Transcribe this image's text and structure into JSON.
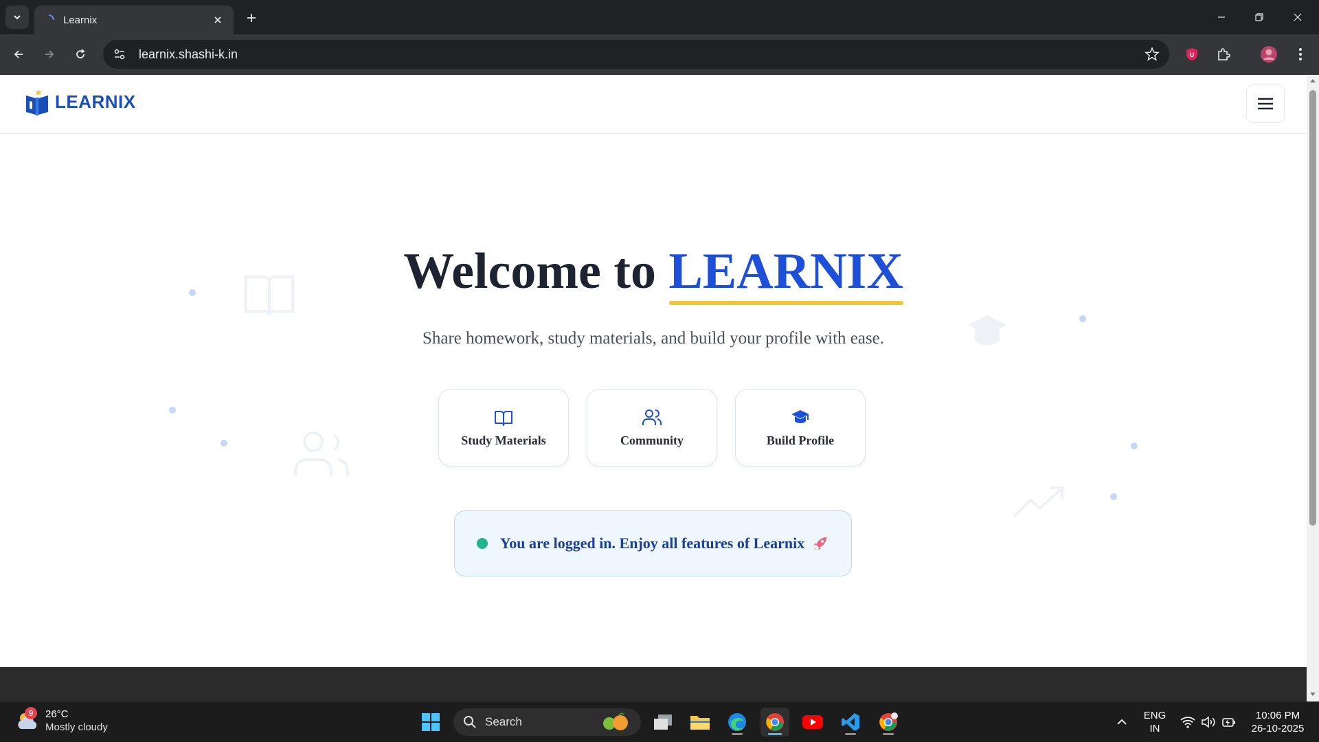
{
  "browser": {
    "tab_title": "Learnix",
    "url": "learnix.shashi-k.in"
  },
  "site": {
    "logo_text": "LEARNIX",
    "hero": {
      "title_prefix": "Welcome to",
      "title_brand": "LEARNIX",
      "subtitle": "Share homework, study materials, and build your profile with ease."
    },
    "features": [
      {
        "label": "Study Materials",
        "icon": "book-open-icon"
      },
      {
        "label": "Community",
        "icon": "users-icon"
      },
      {
        "label": "Build Profile",
        "icon": "graduation-cap-icon"
      }
    ],
    "status_banner": "You are logged in. Enjoy all features of Learnix",
    "colors": {
      "brand_blue": "#1d4fd8",
      "underline_yellow": "#f2c43b",
      "status_green": "#1fb58f",
      "banner_bg": "#eef7fd"
    }
  },
  "taskbar": {
    "weather_badge": "9",
    "weather_temp": "26°C",
    "weather_desc": "Mostly cloudy",
    "search_placeholder": "Search",
    "language_line1": "ENG",
    "language_line2": "IN",
    "time": "10:06 PM",
    "date": "26-10-2025"
  }
}
